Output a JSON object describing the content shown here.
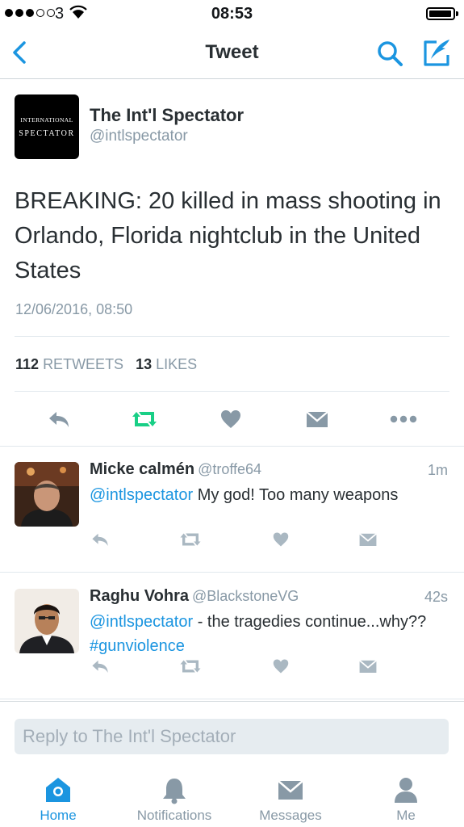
{
  "status_bar": {
    "carrier": "3",
    "time": "08:53",
    "battery_level": 0.95
  },
  "nav": {
    "title": "Tweet"
  },
  "main_tweet": {
    "avatar_line1": "INTERNATIONAL",
    "avatar_line2": "SPECTATOR",
    "name": "The Int'l Spectator",
    "handle": "@intlspectator",
    "text": "BREAKING: 20 killed in mass shooting in Orlando, Florida nightclub in the United States",
    "timestamp": "12/06/2016, 08:50",
    "retweets": "112",
    "retweets_label": "RETWEETS",
    "likes": "13",
    "likes_label": "LIKES"
  },
  "replies": [
    {
      "name": "Micke calmén",
      "handle": "@troffe64",
      "time": "1m",
      "mention": "@intlspectator",
      "text": " My god! Too many weapons",
      "hashtag": ""
    },
    {
      "name": "Raghu Vohra",
      "handle": "@BlackstoneVG",
      "time": "42s",
      "mention": "@intlspectator",
      "text": " - the tragedies continue...why?? ",
      "hashtag": "#gunviolence"
    }
  ],
  "reply_bar": {
    "placeholder": "Reply to The Int'l Spectator"
  },
  "tabs": [
    {
      "label": "Home",
      "icon": "home-icon",
      "active": true
    },
    {
      "label": "Notifications",
      "icon": "bell-icon",
      "active": false
    },
    {
      "label": "Messages",
      "icon": "envelope-icon",
      "active": false
    },
    {
      "label": "Me",
      "icon": "person-icon",
      "active": false
    }
  ],
  "colors": {
    "accent": "#1b95e0",
    "retweet_green": "#19cf86",
    "icon_gray": "#aab8c2",
    "text_gray": "#8899a6"
  }
}
